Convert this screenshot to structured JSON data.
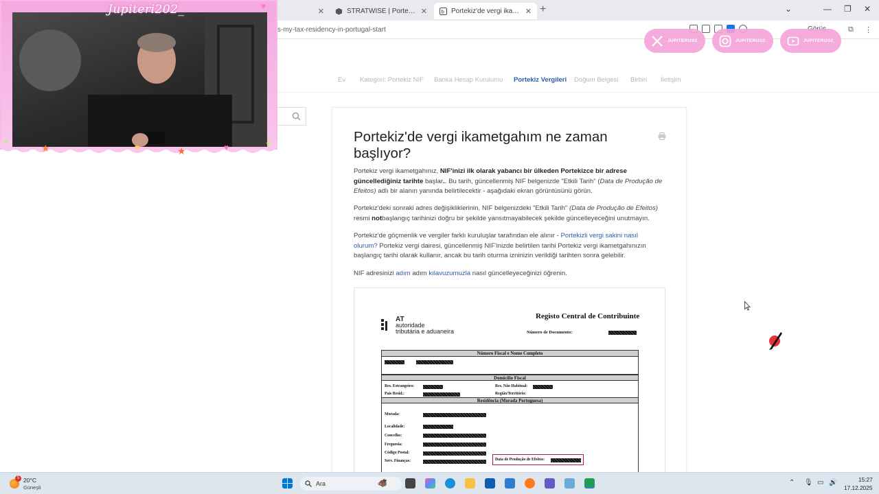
{
  "browser": {
    "tabs": [
      {
        "label": ""
      },
      {
        "label": "STRATWISE | Portekiz'de Net Ve"
      },
      {
        "label": "Portekiz'de vergi ikametgahım ("
      }
    ],
    "url": "s-my-tax-residency-in-portugal-start",
    "share_label": "Görüş"
  },
  "overlay": {
    "name": "Jupiteri202_",
    "socials": [
      "JUPITERI202_",
      "JUPITERI202_",
      "JUPITERI202_"
    ]
  },
  "site": {
    "nav": [
      "Ev",
      "Kategori: Portekiz NIF",
      "Banka Hesap Kurulumu",
      "Portekiz Vergileri",
      "Doğum Belgesi",
      "Birbiri",
      "İletişim"
    ],
    "active_nav": "Portekiz Vergileri"
  },
  "article": {
    "title": "Portekiz'de vergi ikametgahım ne zaman başlıyor?",
    "p1": {
      "a": "Portekiz vergi ikametgahınız, ",
      "b": "NIF'inizi ilk olarak yabancı bir ülkeden Portekizce bir adrese güncellediğiniz tarihte",
      "c": " başlar",
      "d": ". Bu tarih, güncellenmiş NIF belgenizde \"Etkili Tarih\" (",
      "e": "Data de Produção de Efeitos)",
      "f": " adlı bir alanın yanında belirtilecektir - aşağıdaki ekran görüntüsünü görün."
    },
    "p2": {
      "a": "Portekiz'deki sonraki adres değişikliklerinin, NIF belgenizdeki \"Etkili Tarih\" ",
      "b": "(Data de Produção de Efeitos)",
      "c": " resmi ",
      "d": "not",
      "e": "başlangıç tarihinizi doğru bir şekilde yansıtmayabilecek şekilde güncelleyeceğini unutmayın."
    },
    "p3": {
      "a": "Portekiz'de göçmenlik ve vergiler farklı kuruluşlar tarafından ele alınır - ",
      "link": "Portekizli vergi sakini nasıl olurum?",
      "b": " Portekiz vergi dairesi, güncellenmiş NIF'inizde belirtilen tarihi Portekiz vergi ikametgahınızın başlangıç tarihi olarak kullanır, ancak bu tarih oturma izninizin verildiği tarihten sonra gelebilir."
    },
    "p4": {
      "a": "NIF adresinizi ",
      "link1": "adım",
      "b": " adım ",
      "link2": "kılavuzumuzla",
      "c": " nasıl güncelleyeceğinizi öğrenin."
    }
  },
  "nif_document": {
    "logo_at": "AT",
    "logo_line1": "autoridade",
    "logo_line2": "tributária e aduaneira",
    "title": "Registo Central de Contribuinte",
    "doc_number_label": "Número de Documento:",
    "section1": "Número Fiscal e Nome Completo",
    "section2": "Domicílio Fiscal",
    "res_estrangeiro": "Res. Estrangeiro:",
    "res_nao_habitual": "Res. Não Habitual:",
    "pais_resid": "País Resid.:",
    "regiao": "Região/Território:",
    "section3": "Residência (Morada Portuguesa)",
    "morada": "Morada:",
    "localidade": "Localidade:",
    "concelho": "Concelho:",
    "freguesia": "Freguesia:",
    "codigo_postal": "Código Postal:",
    "serv_financas": "Serv. Finanças:",
    "data_efeitos": "Data de Produção de Efeitos:"
  },
  "taskbar": {
    "temp": "20°C",
    "weather": "Güneşli",
    "weather_badge": "5",
    "search": "Ara",
    "time": "15:27",
    "date": "17.12.2025"
  }
}
